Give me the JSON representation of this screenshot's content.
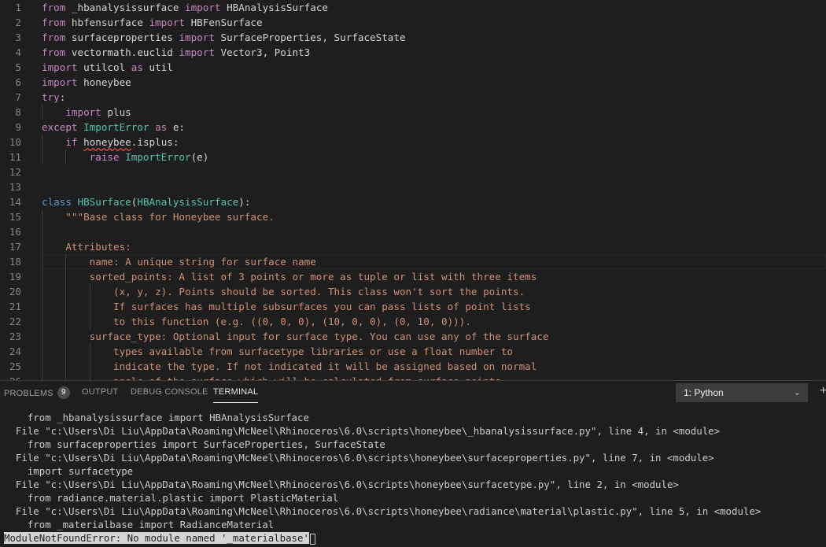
{
  "editor": {
    "active_line": 18,
    "lines": [
      {
        "n": "1",
        "tokens": [
          [
            "kw2",
            "from"
          ],
          [
            "plain",
            " _hbanalysissurface "
          ],
          [
            "kw2",
            "import"
          ],
          [
            "plain",
            " HBAnalysisSurface"
          ]
        ]
      },
      {
        "n": "2",
        "tokens": [
          [
            "kw2",
            "from"
          ],
          [
            "plain",
            " hbfensurface "
          ],
          [
            "kw2",
            "import"
          ],
          [
            "plain",
            " HBFenSurface"
          ]
        ]
      },
      {
        "n": "3",
        "tokens": [
          [
            "kw2",
            "from"
          ],
          [
            "plain",
            " surfaceproperties "
          ],
          [
            "kw2",
            "import"
          ],
          [
            "plain",
            " SurfaceProperties, SurfaceState"
          ]
        ]
      },
      {
        "n": "4",
        "tokens": [
          [
            "kw2",
            "from"
          ],
          [
            "plain",
            " vectormath.euclid "
          ],
          [
            "kw2",
            "import"
          ],
          [
            "plain",
            " Vector3, Point3"
          ]
        ]
      },
      {
        "n": "5",
        "tokens": [
          [
            "kw2",
            "import"
          ],
          [
            "plain",
            " utilcol "
          ],
          [
            "kw2",
            "as"
          ],
          [
            "plain",
            " util"
          ]
        ]
      },
      {
        "n": "6",
        "tokens": [
          [
            "kw2",
            "import"
          ],
          [
            "plain",
            " honeybee"
          ]
        ]
      },
      {
        "n": "7",
        "tokens": [
          [
            "kw2",
            "try"
          ],
          [
            "plain",
            ":"
          ]
        ]
      },
      {
        "n": "8",
        "tokens": [
          [
            "plain",
            "    "
          ],
          [
            "kw2",
            "import"
          ],
          [
            "plain",
            " plus"
          ]
        ]
      },
      {
        "n": "9",
        "tokens": [
          [
            "kw2",
            "except"
          ],
          [
            "plain",
            " "
          ],
          [
            "cls",
            "ImportError"
          ],
          [
            "plain",
            " "
          ],
          [
            "kw2",
            "as"
          ],
          [
            "plain",
            " e:"
          ]
        ]
      },
      {
        "n": "10",
        "tokens": [
          [
            "plain",
            "    "
          ],
          [
            "kw2",
            "if"
          ],
          [
            "plain",
            " "
          ],
          [
            "squiggle",
            "honeybee"
          ],
          [
            "plain",
            ".isplus:"
          ]
        ]
      },
      {
        "n": "11",
        "tokens": [
          [
            "plain",
            "        "
          ],
          [
            "kw2",
            "raise"
          ],
          [
            "plain",
            " "
          ],
          [
            "cls",
            "ImportError"
          ],
          [
            "plain",
            "(e)"
          ]
        ]
      },
      {
        "n": "12",
        "tokens": []
      },
      {
        "n": "13",
        "tokens": []
      },
      {
        "n": "14",
        "tokens": [
          [
            "kw",
            "class"
          ],
          [
            "plain",
            " "
          ],
          [
            "cls",
            "HBSurface"
          ],
          [
            "plain",
            "("
          ],
          [
            "cls",
            "HBAnalysisSurface"
          ],
          [
            "plain",
            "):"
          ]
        ]
      },
      {
        "n": "15",
        "tokens": [
          [
            "plain",
            "    "
          ],
          [
            "str",
            "\"\"\"Base class for Honeybee surface."
          ]
        ]
      },
      {
        "n": "16",
        "tokens": []
      },
      {
        "n": "17",
        "tokens": [
          [
            "plain",
            "    "
          ],
          [
            "str",
            "Attributes:"
          ]
        ]
      },
      {
        "n": "18",
        "tokens": [
          [
            "plain",
            "        "
          ],
          [
            "str",
            "name: A unique string for surface name"
          ]
        ]
      },
      {
        "n": "19",
        "tokens": [
          [
            "plain",
            "        "
          ],
          [
            "str",
            "sorted_points: A list of 3 points or more as tuple or list with three items"
          ]
        ]
      },
      {
        "n": "20",
        "tokens": [
          [
            "plain",
            "            "
          ],
          [
            "str",
            "(x, y, z). Points should be sorted. This class won't sort the points."
          ]
        ]
      },
      {
        "n": "21",
        "tokens": [
          [
            "plain",
            "            "
          ],
          [
            "str",
            "If surfaces has multiple subsurfaces you can pass lists of point lists"
          ]
        ]
      },
      {
        "n": "22",
        "tokens": [
          [
            "plain",
            "            "
          ],
          [
            "str",
            "to this function (e.g. ((0, 0, 0), (10, 0, 0), (0, 10, 0)))."
          ]
        ]
      },
      {
        "n": "23",
        "tokens": [
          [
            "plain",
            "        "
          ],
          [
            "str",
            "surface_type: Optional input for surface type. You can use any of the surface"
          ]
        ]
      },
      {
        "n": "24",
        "tokens": [
          [
            "plain",
            "            "
          ],
          [
            "str",
            "types available from surfacetype libraries or use a float number to"
          ]
        ]
      },
      {
        "n": "25",
        "tokens": [
          [
            "plain",
            "            "
          ],
          [
            "str",
            "indicate the type. If not indicated it will be assigned based on normal"
          ]
        ]
      },
      {
        "n": "26",
        "tokens": [
          [
            "plain",
            "            "
          ],
          [
            "str",
            "angle of the surface which will be calculated from surface points."
          ]
        ]
      }
    ]
  },
  "panel": {
    "tabs": [
      {
        "label": "PROBLEMS",
        "badge": "9",
        "active": false
      },
      {
        "label": "OUTPUT",
        "active": false
      },
      {
        "label": "DEBUG CONSOLE",
        "active": false
      },
      {
        "label": "TERMINAL",
        "active": true
      }
    ],
    "terminal_select": "1: Python",
    "chevron_icon": "chevron-down-icon",
    "add_icon": "plus-icon",
    "terminal_lines": [
      "    from _hbanalysissurface import HBAnalysisSurface",
      "  File \"c:\\Users\\Di Liu\\AppData\\Roaming\\McNeel\\Rhinoceros\\6.0\\scripts\\honeybee\\_hbanalysissurface.py\", line 4, in <module>",
      "    from surfaceproperties import SurfaceProperties, SurfaceState",
      "  File \"c:\\Users\\Di Liu\\AppData\\Roaming\\McNeel\\Rhinoceros\\6.0\\scripts\\honeybee\\surfaceproperties.py\", line 7, in <module>",
      "    import surfacetype",
      "  File \"c:\\Users\\Di Liu\\AppData\\Roaming\\McNeel\\Rhinoceros\\6.0\\scripts\\honeybee\\surfacetype.py\", line 2, in <module>",
      "    from radiance.material.plastic import PlasticMaterial",
      "  File \"c:\\Users\\Di Liu\\AppData\\Roaming\\McNeel\\Rhinoceros\\6.0\\scripts\\honeybee\\radiance\\material\\plastic.py\", line 5, in <module>",
      "    from _materialbase import RadianceMaterial"
    ],
    "error_line": "ModuleNotFoundError: No module named '_materialbase'"
  },
  "colors": {
    "background": "#1e1e1e",
    "keyword": "#c586c0",
    "class_keyword": "#569cd6",
    "type_name": "#4ec9b0",
    "string": "#ce9178",
    "line_number": "#858585"
  }
}
